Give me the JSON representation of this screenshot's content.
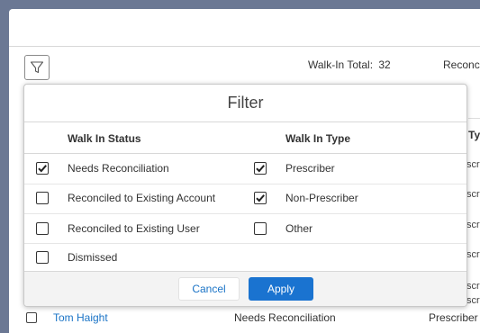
{
  "toolbar": {
    "walkin_total_label": "Walk-In Total:",
    "walkin_total_value": "32",
    "reconciled_label": "Reconc"
  },
  "background_table": {
    "type_header_partial": "Ty",
    "type_cells_partial": [
      "scr",
      "scr",
      "scr",
      "scr",
      "scr",
      "scr"
    ]
  },
  "bottom_row": {
    "name": "Tom Haight",
    "status": "Needs Reconciliation",
    "type": "Prescriber"
  },
  "filter": {
    "title": "Filter",
    "status_header": "Walk In Status",
    "type_header": "Walk In Type",
    "status_options": [
      {
        "label": "Needs Reconciliation",
        "checked": true
      },
      {
        "label": "Reconciled to Existing Account",
        "checked": false
      },
      {
        "label": "Reconciled to Existing User",
        "checked": false
      },
      {
        "label": "Dismissed",
        "checked": false
      }
    ],
    "type_options": [
      {
        "label": "Prescriber",
        "checked": true
      },
      {
        "label": "Non-Prescriber",
        "checked": true
      },
      {
        "label": "Other",
        "checked": false
      }
    ],
    "cancel_label": "Cancel",
    "apply_label": "Apply"
  },
  "icons": {
    "filter": "filter-funnel-icon",
    "check": "checkmark-icon"
  },
  "colors": {
    "accent": "#1a73d0",
    "link": "#1a73c6",
    "backdrop": "#6b7894"
  }
}
